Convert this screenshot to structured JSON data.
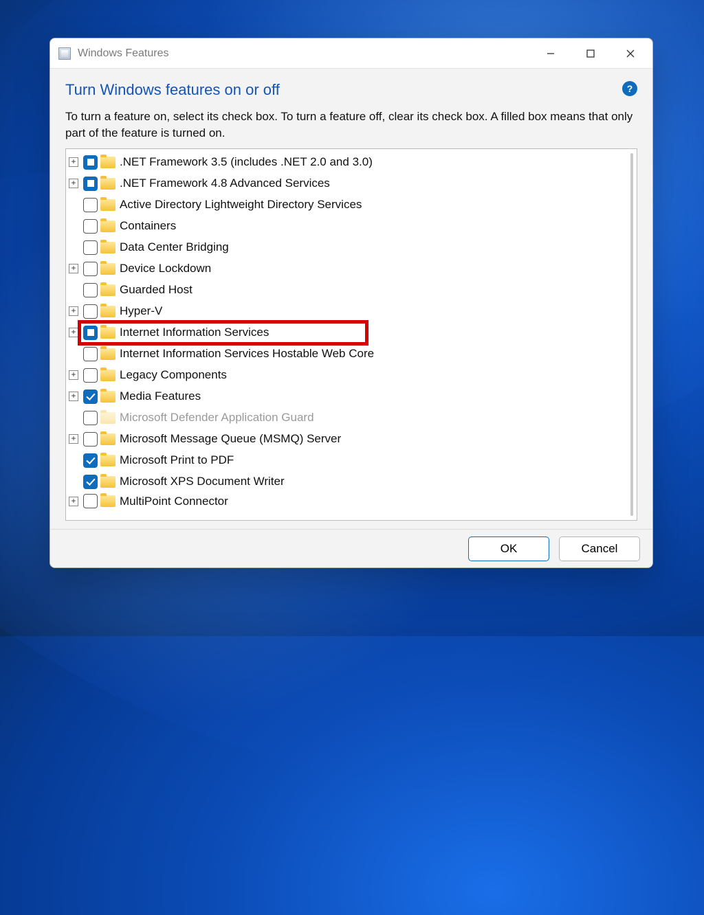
{
  "window": {
    "title": "Windows Features"
  },
  "header": {
    "heading": "Turn Windows features on or off",
    "description": "To turn a feature on, select its check box. To turn a feature off, clear its check box. A filled box means that only part of the feature is turned on.",
    "help_tooltip": "?"
  },
  "features": {
    "net35": ".NET Framework 3.5 (includes .NET 2.0 and 3.0)",
    "net48": ".NET Framework 4.8 Advanced Services",
    "adlds": "Active Directory Lightweight Directory Services",
    "containers": "Containers",
    "dcb": "Data Center Bridging",
    "device_lockdown": "Device Lockdown",
    "guarded_host": "Guarded Host",
    "hyperv": "Hyper-V",
    "iis": "Internet Information Services",
    "iis_core": "Internet Information Services Hostable Web Core",
    "legacy": "Legacy Components",
    "media": "Media Features",
    "defender_ag": "Microsoft Defender Application Guard",
    "msmq": "Microsoft Message Queue (MSMQ) Server",
    "print_pdf": "Microsoft Print to PDF",
    "xps_writer": "Microsoft XPS Document Writer",
    "multipoint": "MultiPoint Connector"
  },
  "buttons": {
    "ok": "OK",
    "cancel": "Cancel"
  }
}
